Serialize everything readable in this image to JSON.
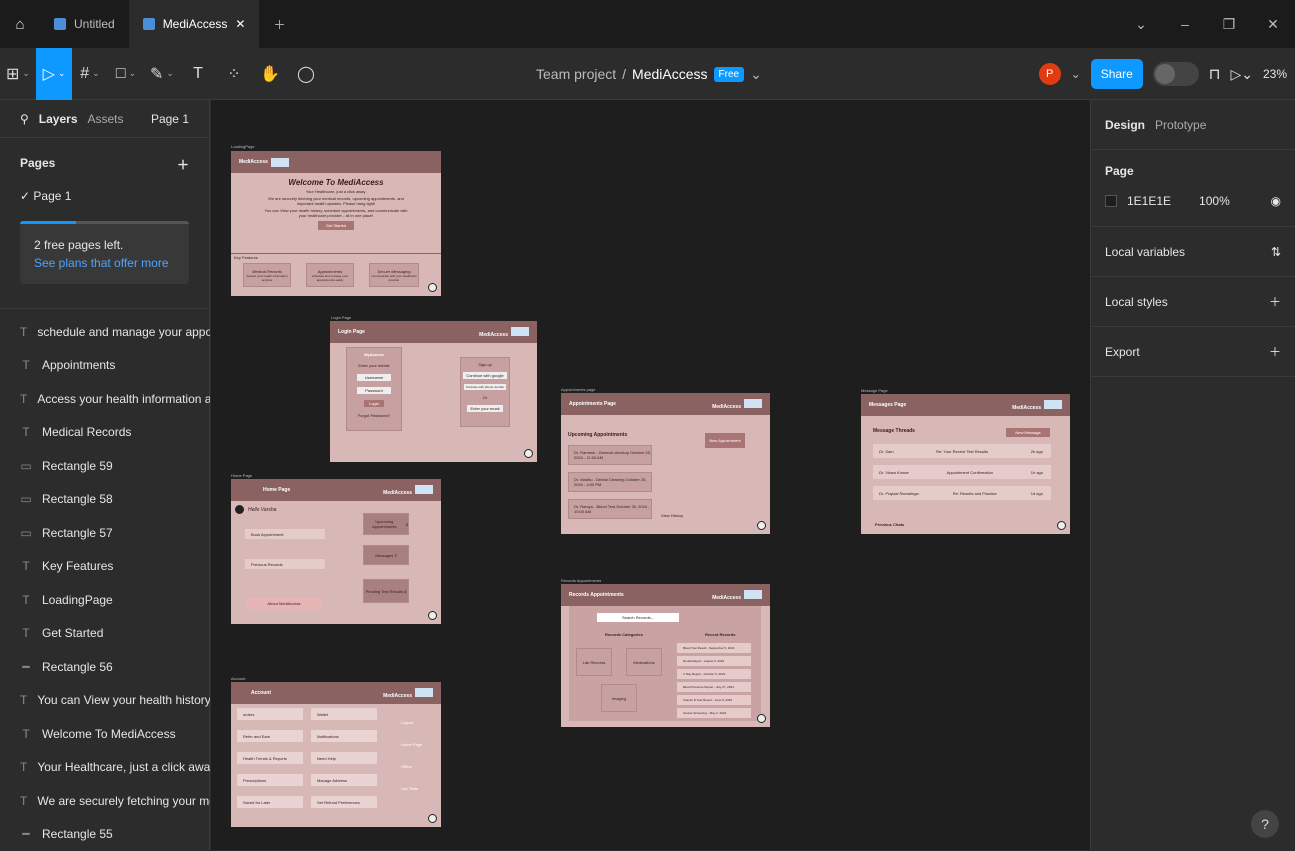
{
  "tabs": [
    {
      "label": "Untitled",
      "active": false
    },
    {
      "label": "MediAccess",
      "active": true
    }
  ],
  "toolbar": {
    "project": "Team project",
    "separator": "/",
    "file": "MediAccess",
    "plan": "Free",
    "share": "Share",
    "zoom": "23%",
    "user_initial": "P",
    "text_tool": "T"
  },
  "left_panel": {
    "layers_tab": "Layers",
    "assets_tab": "Assets",
    "page_selector": "Page 1",
    "pages_title": "Pages",
    "current_page": "Page 1",
    "upsell_text": "2 free pages left.",
    "upsell_link": "See plans that offer more",
    "layers": [
      {
        "type": "text",
        "label": "schedule and manage your appoin..."
      },
      {
        "type": "text",
        "label": "Appointments"
      },
      {
        "type": "text",
        "label": "Access your health information an..."
      },
      {
        "type": "text",
        "label": "Medical Records"
      },
      {
        "type": "rect",
        "label": "Rectangle 59"
      },
      {
        "type": "rect",
        "label": "Rectangle 58"
      },
      {
        "type": "rect",
        "label": "Rectangle 57"
      },
      {
        "type": "text",
        "label": "Key Features"
      },
      {
        "type": "text",
        "label": "LoadingPage"
      },
      {
        "type": "text",
        "label": "Get Started"
      },
      {
        "type": "line",
        "label": "Rectangle 56"
      },
      {
        "type": "text",
        "label": "You can View your health history, ..."
      },
      {
        "type": "text",
        "label": "Welcome To MediAccess"
      },
      {
        "type": "text",
        "label": "Your Healthcare, just a click away."
      },
      {
        "type": "text",
        "label": "We are securely fetching your med..."
      },
      {
        "type": "line",
        "label": "Rectangle 55"
      }
    ]
  },
  "right_panel": {
    "design_tab": "Design",
    "prototype_tab": "Prototype",
    "page_title": "Page",
    "bg_color": "1E1E1E",
    "opacity": "100%",
    "local_variables": "Local variables",
    "local_styles": "Local styles",
    "export": "Export",
    "help": "?"
  },
  "frames": {
    "loading": {
      "label": "LoadingPage",
      "brand": "MediAccess",
      "title": "Welcome To MediAccess",
      "tagline": "Your Healthcare, just a click away.",
      "body1": "We are securely fetching your medical records, upcoming appointments, and important health updates. Please hang tight!",
      "body2": "You can View your health history, schedule appointments, and communicate with your healthcare provider - all in one place!",
      "cta": "Get Started",
      "features_title": "Key Features",
      "features": [
        {
          "title": "Medical Records",
          "desc": "Access your health information anytime"
        },
        {
          "title": "Appointments",
          "desc": "schedule and manage your appointments easily"
        },
        {
          "title": "Secure Messaging",
          "desc": "communicate with your healthcare provider"
        }
      ]
    },
    "login": {
      "label": "Login Page",
      "title": "Login Page",
      "brand": "MediAccess",
      "box_title": "MyAccess",
      "prompt": "Enter your details",
      "username": "Username",
      "password": "Password",
      "login": "Login",
      "forgot": "Forgot Password?",
      "signup": "Sign up",
      "google": "Continue with google",
      "apple": "Continue with phone number",
      "or": "Or",
      "email": "Enter your email"
    },
    "home": {
      "label": "Home Page",
      "title": "Home Page",
      "brand": "MediAccess",
      "greeting": "Hello Varsha",
      "book": "Book Appointment",
      "previous": "Previous Records",
      "about": "About MediAccess",
      "upcoming": "Upcoming Appointments",
      "messages": "Messages",
      "pending": "Pending Test Results",
      "upcoming_count": "2",
      "messages_count": "7",
      "pending_count": "2"
    },
    "account": {
      "label": "Account",
      "title": "Account",
      "brand": "MediAccess",
      "items": [
        "orders",
        "Wallet",
        "Refer and Earn",
        "Notifications",
        "Health Trends & Reports",
        "Need Help",
        "Prescriptions",
        "Manage Address",
        "Saved for Later",
        "Set Refund Preferences"
      ],
      "side": [
        "Logout",
        "Home Page",
        "Offers",
        "Lab Tests"
      ]
    },
    "appointments": {
      "label": "Appointments page",
      "title": "Appointments Page",
      "brand": "MediAccess",
      "section": "Upcoming Appointments",
      "new_btn": "New Appointment",
      "items": [
        "Dr. Ramesh - General checkup October 25, 2024 - 11:00 AM",
        "Dr. Madhu - Dental Cleaning October 25, 2024 - 4:00 PM",
        "Dr. Ramya - Blood Test October 30, 2024 - 10:00 AM"
      ],
      "history": "View History"
    },
    "records": {
      "label": "Records Appointments",
      "title": "Records Appointments",
      "brand": "MediAccess",
      "search": "Search Records...",
      "categories_title": "Records Categories",
      "recent_title": "Recent Records",
      "categories": [
        "Lab Records",
        "Medications",
        "Imaging"
      ],
      "recent": [
        "Blood Test Result - September 5, 2024",
        "Dental Report - August 3, 2024",
        "X Ray Report - October 5, 2024",
        "Blood Pressure Report - July 27, 2024",
        "Vitamin D Test Report - June 8, 2024",
        "Cancer Screening - May 2, 2024"
      ]
    },
    "messages": {
      "label": "Message Page",
      "title": "Messages Page",
      "brand": "MediAccess",
      "section": "Message Threads",
      "new_btn": "New Message",
      "threads": [
        {
          "name": "Dr. Sam",
          "subject": "Re: Your Recent Test Results",
          "time": "2h ago"
        },
        {
          "name": "Dr. Viswa Kumar",
          "subject": "Appointment Confirmation",
          "time": "1h ago"
        },
        {
          "name": "Dr. Prajwal Ramalinga",
          "subject": "Re: Results and Practice",
          "time": "1d ago"
        }
      ],
      "previous": "Previous Chats"
    }
  }
}
